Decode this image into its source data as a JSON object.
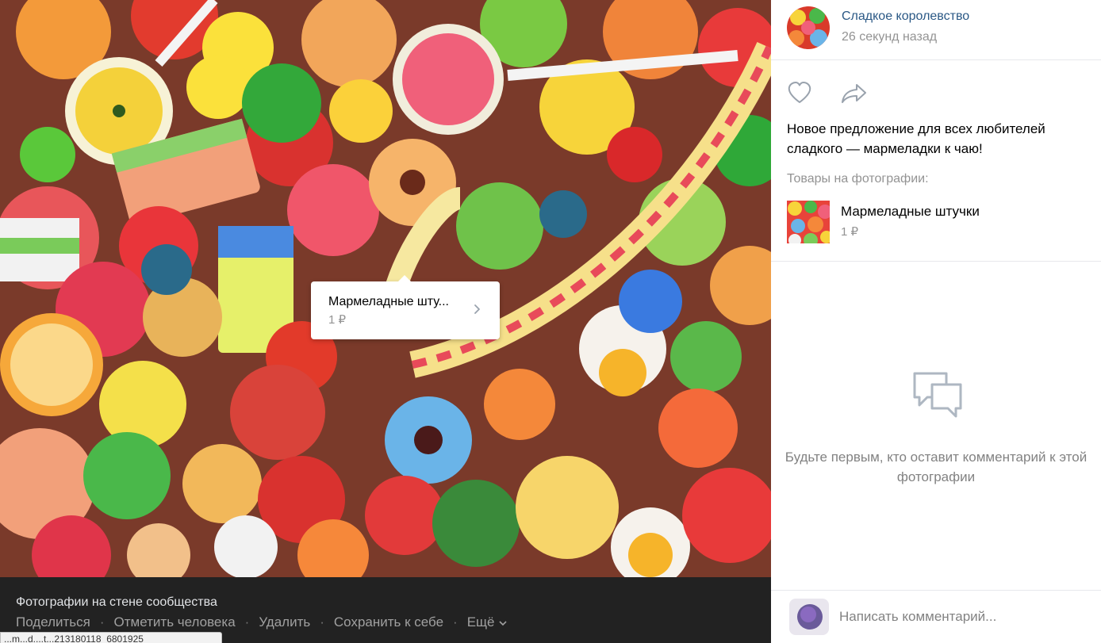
{
  "photo": {
    "tag": {
      "title": "Мармеладные шту...",
      "price": "1 ₽"
    }
  },
  "bottom_bar": {
    "album_title": "Фотографии на стене сообщества",
    "actions": {
      "share": "Поделиться",
      "tag_person": "Отметить человека",
      "delete": "Удалить",
      "save": "Сохранить к себе",
      "more": "Ещё"
    },
    "url_fragment": "...m...d....t...213180118_6801925"
  },
  "side": {
    "author": "Сладкое королевство",
    "time": "26 секунд назад",
    "post_text": "Новое предложение для всех любителей сладкого — мармеладки к чаю!",
    "goods_label": "Товары на фотографии:",
    "product": {
      "name": "Мармеладные штучки",
      "price": "1 ₽"
    },
    "empty_comments": "Будьте первым, кто оставит комментарий к этой фотографии",
    "comment_placeholder": "Написать комментарий..."
  },
  "colors": {
    "link": "#2a5885",
    "muted": "#939393",
    "dark_bar": "#222222",
    "divider": "#e7e8ec"
  },
  "icons": {
    "like": "heart-icon",
    "share": "share-arrow-icon",
    "comments": "speech-bubbles-icon",
    "chevron": "chevron-right-icon"
  }
}
